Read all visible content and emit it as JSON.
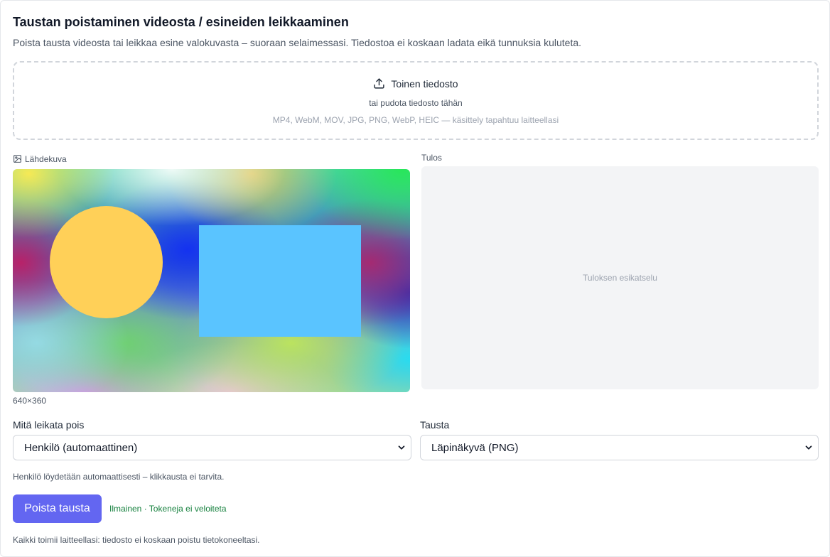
{
  "header": {
    "title": "Taustan poistaminen videosta / esineiden leikkaaminen",
    "subtitle": "Poista tausta videosta tai leikkaa esine valokuvasta – suoraan selaimessasi. Tiedostoa ei koskaan ladata eikä tunnuksia kuluteta."
  },
  "dropzone": {
    "upload_label": "Toinen tiedosto",
    "drop_hint": "tai pudota tiedosto tähän",
    "formats": "MP4, WebM, MOV, JPG, PNG, WebP, HEIC — käsittely tapahtuu laitteellasi"
  },
  "source": {
    "label": "Lähdekuva",
    "dimensions": "640×360"
  },
  "result": {
    "label": "Tulos",
    "placeholder": "Tuloksen esikatselu"
  },
  "options": {
    "cut_label": "Mitä leikata pois",
    "cut_value": "Henkilö (automaattinen)",
    "bg_label": "Tausta",
    "bg_value": "Läpinäkyvä (PNG)"
  },
  "hint": "Henkilö löydetään automaattisesti – klikkausta ei tarvita.",
  "action": {
    "button_label": "Poista tausta",
    "free_note": "Ilmainen · Tokeneja ei veloiteta"
  },
  "footer": "Kaikki toimii laitteellasi: tiedosto ei koskaan poistu tietokoneeltasi.",
  "colors": {
    "primary": "#6366f1",
    "free_note": "#15803d"
  }
}
